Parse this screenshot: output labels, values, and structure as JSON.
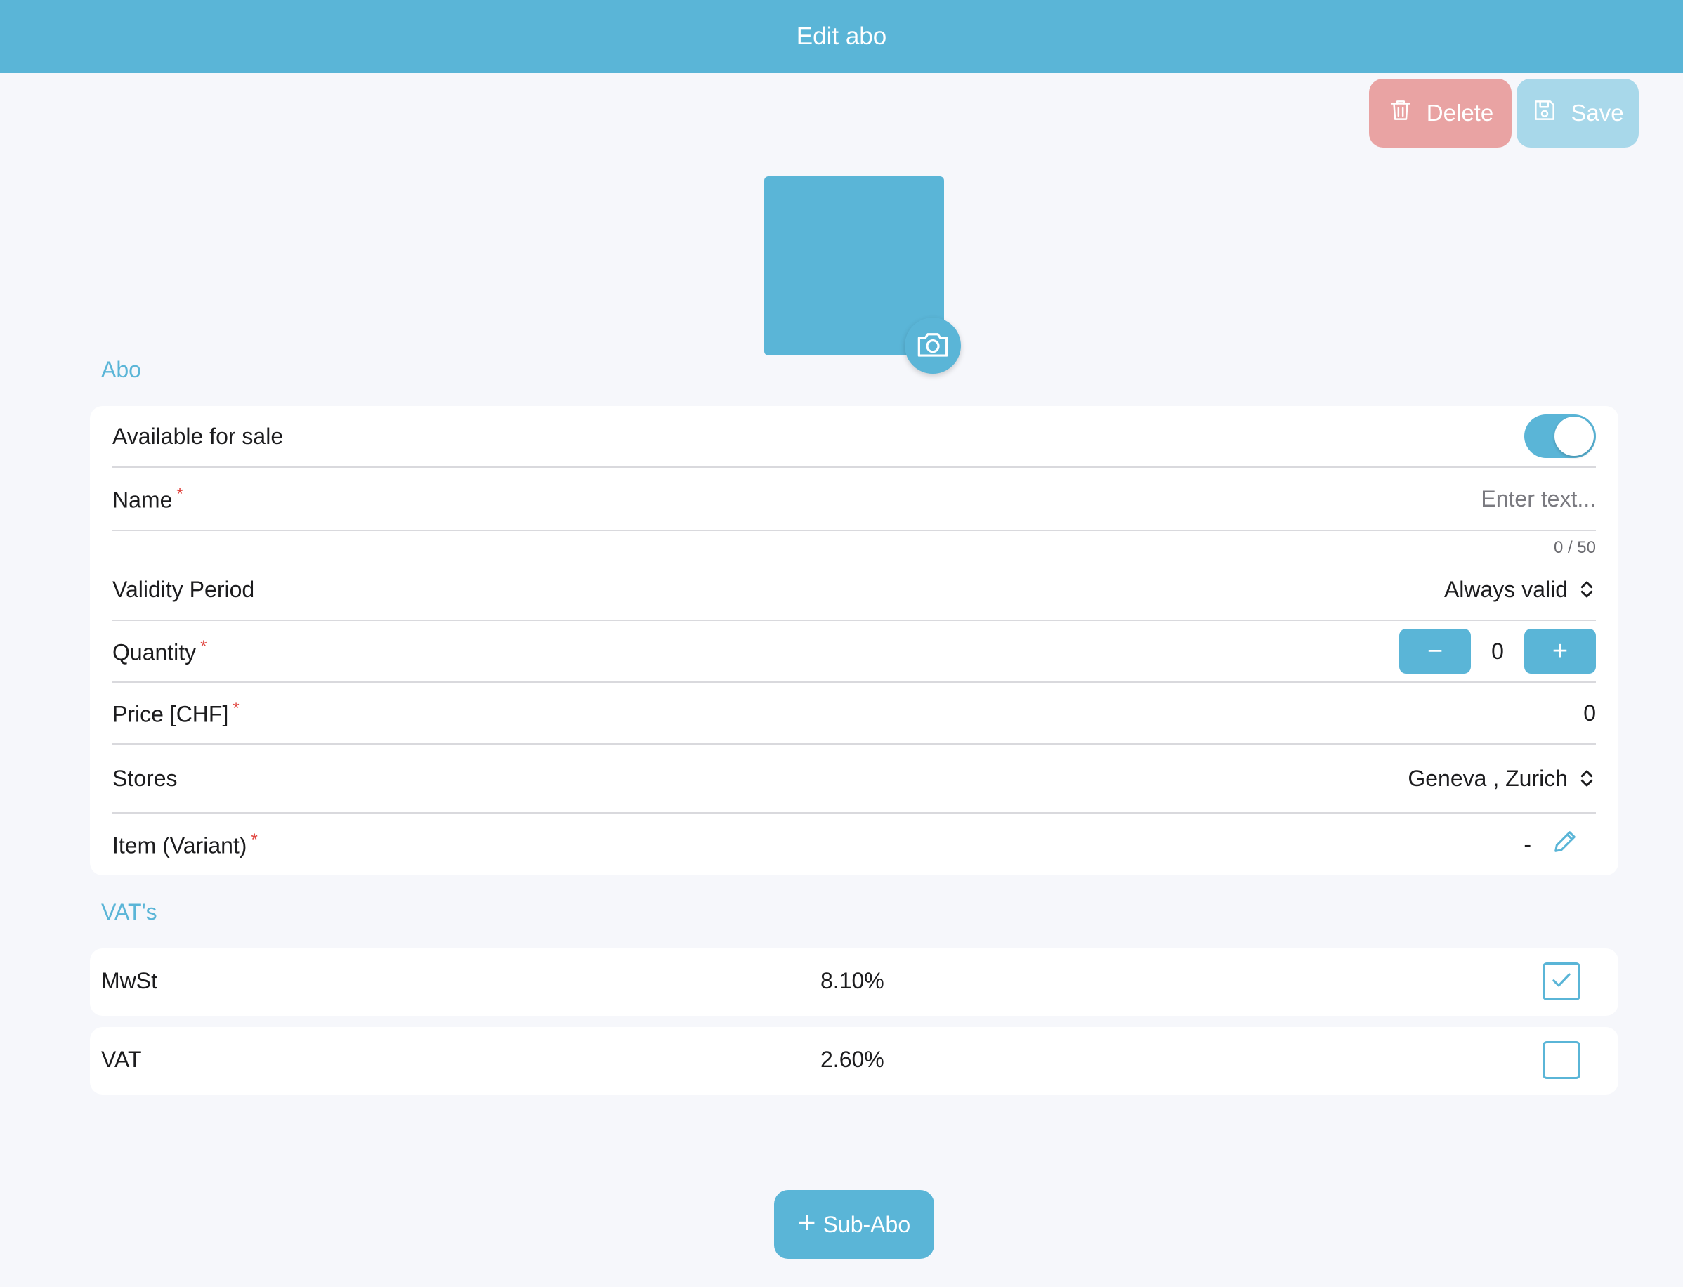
{
  "header": {
    "title": "Edit abo"
  },
  "actions": {
    "delete_label": "Delete",
    "save_label": "Save"
  },
  "sections": {
    "abo": "Abo",
    "vats": "VAT's"
  },
  "form": {
    "available_for_sale": {
      "label": "Available for sale",
      "value": true
    },
    "name": {
      "label": "Name",
      "required": "*",
      "value": "",
      "placeholder": "Enter text...",
      "counter": "0 / 50"
    },
    "validity": {
      "label": "Validity Period",
      "value": "Always valid"
    },
    "quantity": {
      "label": "Quantity",
      "required": "*",
      "minus": "−",
      "value": "0",
      "plus": "+"
    },
    "price": {
      "label": "Price [CHF]",
      "required": "*",
      "value": "0"
    },
    "stores": {
      "label": "Stores",
      "value": "Geneva , Zurich"
    },
    "item_variant": {
      "label": "Item (Variant)",
      "required": "*",
      "value": "-"
    }
  },
  "vats": [
    {
      "name": "MwSt",
      "rate": "8.10%",
      "checked": true
    },
    {
      "name": "VAT",
      "rate": "2.60%",
      "checked": false
    }
  ],
  "footer": {
    "add_plus": "+",
    "add_label": "Sub-Abo"
  },
  "colors": {
    "primary": "#5ab5d7",
    "delete": "#e9a3a3",
    "save_disabled": "#a8d8ea",
    "required": "#e0453f"
  },
  "icons": [
    "trash-icon",
    "save-icon",
    "camera-icon",
    "chevron-updown-icon",
    "pencil-icon",
    "checkmark-icon"
  ]
}
